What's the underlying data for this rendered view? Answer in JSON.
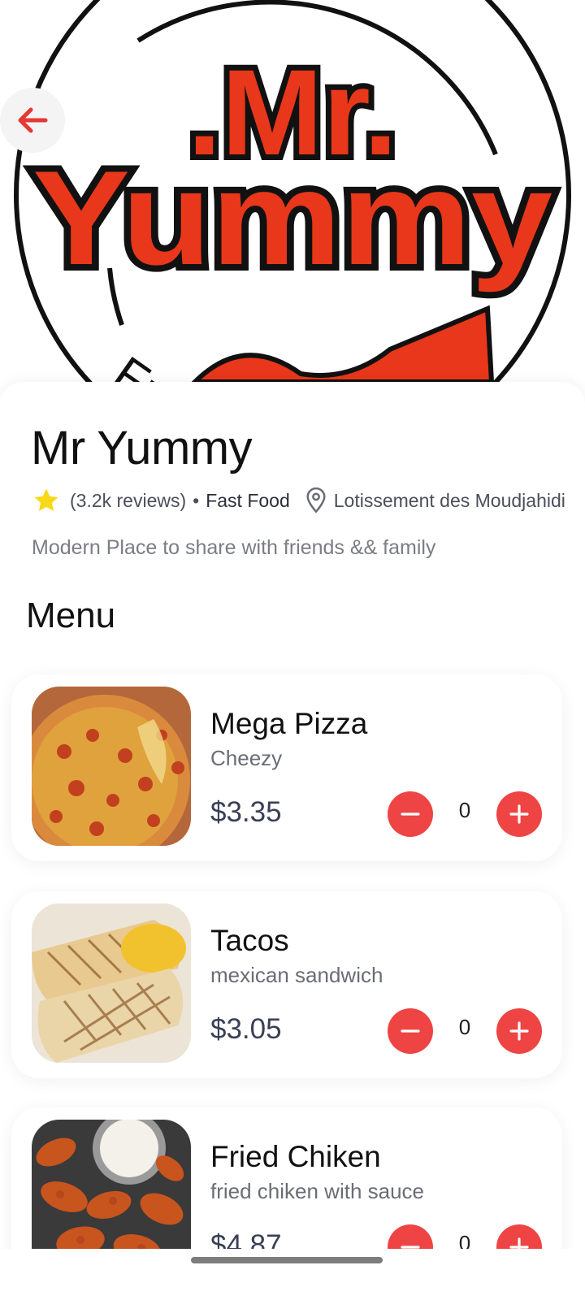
{
  "status_bar": {
    "time": "",
    "icons": [
      "settings-icon",
      "battery-icon"
    ]
  },
  "hero": {
    "logo_text_line1": ".Mr.",
    "logo_text_line2": "Yummy",
    "logo_ring_text": "Fre",
    "colors": {
      "logo_red": "#e8371a",
      "logo_outline": "#111111"
    }
  },
  "back_button": {
    "icon": "arrow-left-icon",
    "color": "#e53935"
  },
  "restaurant": {
    "name": "Mr Yummy",
    "reviews": "(3.2k reviews)",
    "separator": "•",
    "category": "Fast Food",
    "location": "Lotissement des Moudjahidi",
    "description": "Modern Place to share with friends && family",
    "rating_icon": "star-icon",
    "location_icon": "map-pin-icon"
  },
  "menu": {
    "heading": "Menu",
    "items": [
      {
        "name": "Mega Pizza",
        "subtitle": "Cheezy",
        "price": "$3.35",
        "quantity": "0",
        "image": "pizza-image"
      },
      {
        "name": "Tacos",
        "subtitle": "mexican sandwich",
        "price": "$3.05",
        "quantity": "0",
        "image": "tacos-image"
      },
      {
        "name": "Fried Chiken",
        "subtitle": "fried chiken with sauce",
        "price": "$4.87",
        "quantity": "0",
        "image": "chicken-wings-image"
      }
    ]
  },
  "colors": {
    "accent": "#ef4444",
    "star": "#f7d917",
    "text_primary": "#111111",
    "text_muted": "#7a7d85"
  }
}
